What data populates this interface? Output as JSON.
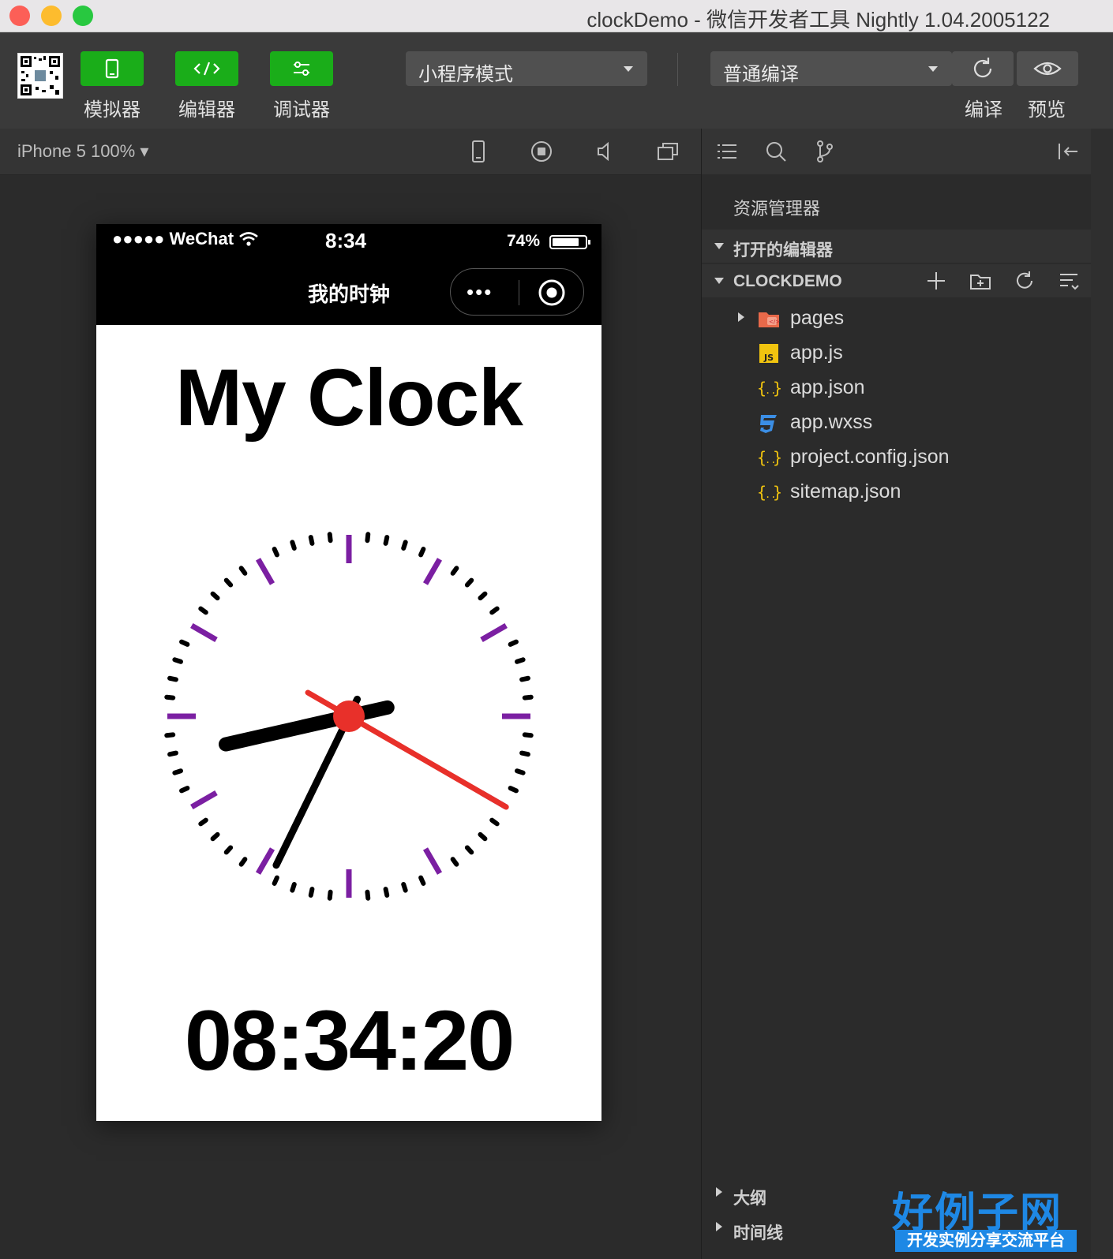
{
  "window": {
    "title": "clockDemo - 微信开发者工具 Nightly 1.04.2005122"
  },
  "toolbar": {
    "simulator_label": "模拟器",
    "editor_label": "编辑器",
    "debugger_label": "调试器",
    "mode_value": "小程序模式",
    "compile_value": "普通编译",
    "compile_label": "编译",
    "preview_label": "预览"
  },
  "simulator": {
    "device": "iPhone 5 100% ▾"
  },
  "phone": {
    "status_left": "●●●●● WeChat",
    "status_time": "8:34",
    "battery_percent": "74%",
    "nav_title": "我的时钟",
    "capsule_dots": "•••",
    "heading": "My Clock",
    "digital_time": "08:34:20",
    "analog": {
      "hour": 8,
      "minute": 34,
      "second": 20
    }
  },
  "explorer": {
    "heading": "资源管理器",
    "open_editors": "打开的编辑器",
    "project": "CLOCKDEMO",
    "files": [
      {
        "name": "pages",
        "icon": "folder-icon"
      },
      {
        "name": "app.js",
        "icon": "js-icon"
      },
      {
        "name": "app.json",
        "icon": "json-icon"
      },
      {
        "name": "app.wxss",
        "icon": "css-icon"
      },
      {
        "name": "project.config.json",
        "icon": "json-icon"
      },
      {
        "name": "sitemap.json",
        "icon": "json-icon"
      }
    ],
    "outline": "大纲",
    "timeline": "时间线"
  },
  "brand": {
    "name": "好例子网",
    "tagline": "开发实例分享交流平台"
  },
  "colors": {
    "accent_green": "#1aad19",
    "clock_second_hand": "#e8302a",
    "clock_major_tick": "#7b1fa2"
  }
}
